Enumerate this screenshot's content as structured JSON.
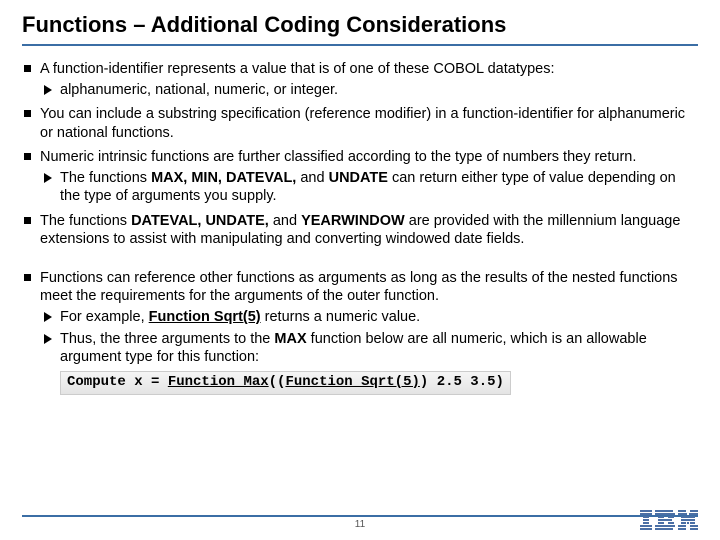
{
  "title": "Functions – Additional Coding Considerations",
  "b1": "A function-identifier represents a value that is of one of these COBOL datatypes:",
  "b1s1": "alphanumeric, national, numeric, or integer.",
  "b2": "You can include a substring specification (reference modifier) in a function-identifier for alphanumeric or national functions.",
  "b3": "Numeric intrinsic functions are further classified according to the type of numbers they return.",
  "b3s1_a": "The functions ",
  "b3s1_b": "MAX, MIN, DATEVAL,",
  "b3s1_c": " and ",
  "b3s1_d": "UNDATE",
  "b3s1_e": " can return either type of value depending on the type of arguments you supply.",
  "b4_a": "The functions ",
  "b4_b": "DATEVAL, UNDATE,",
  "b4_c": " and ",
  "b4_d": "YEARWINDOW",
  "b4_e": " are provided with the millennium language extensions to assist with manipulating and converting windowed date fields.",
  "b5": "Functions can reference other functions as arguments as long as the results of the nested functions meet the requirements for the arguments of the outer function.",
  "b5s1_a": "For example, ",
  "b5s1_b": "Function Sqrt(5)",
  "b5s1_c": " returns a numeric value.",
  "b5s2_a": "Thus, the three arguments to the ",
  "b5s2_b": "MAX",
  "b5s2_c": " function below are all numeric, which is an allowable argument type for this function:",
  "code_a": "Compute x = ",
  "code_b": "Function Max",
  "code_c": "((",
  "code_d": "Function Sqrt(5)",
  "code_e": ") 2.5 3.5)",
  "page": "11"
}
